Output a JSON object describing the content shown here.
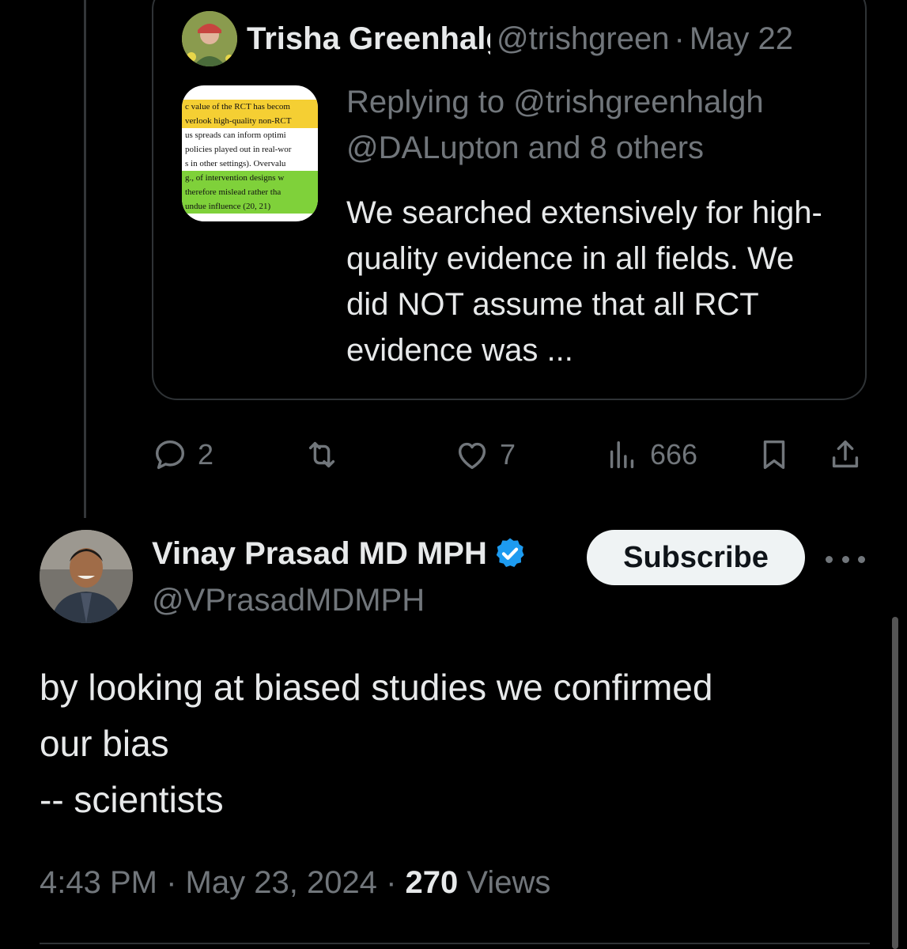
{
  "quoted_tweet": {
    "author_name": "Trisha Greenhalgh",
    "author_handle": "@trishgreen",
    "separator": "·",
    "date": "May 22",
    "replying_to_line1": "Replying to @trishgreenhalgh",
    "replying_to_line2": "@DALupton and 8 others",
    "text": "We searched extensively for high-quality evidence in all fields. We did NOT assume that all RCT evidence was ...",
    "thumbnail_lines": [
      "c value of the RCT has becom",
      "verlook high-quality non-RCT",
      "us spreads can inform optimi",
      "policies played out in real-wor",
      "s in other settings). Overvalu",
      "g., of intervention designs w",
      "therefore mislead rather tha",
      "undue influence (20, 21)"
    ]
  },
  "actions": {
    "reply_count": "2",
    "retweet_count": "",
    "like_count": "7",
    "view_count": "666"
  },
  "main_tweet": {
    "author_name": "Vinay Prasad MD MPH",
    "author_handle": "@VPrasadMDMPH",
    "subscribe_label": "Subscribe",
    "text_lines": [
      "by looking at biased studies we confirmed",
      "our bias",
      "-- scientists"
    ],
    "time": "4:43 PM",
    "date": "May 23, 2024",
    "separator": "·",
    "views_count": "270",
    "views_label": "Views"
  },
  "colors": {
    "background": "#000000",
    "text_primary": "#e7e9ea",
    "text_secondary": "#71767b",
    "verified_blue": "#1d9bf0",
    "border": "#2f3336"
  }
}
